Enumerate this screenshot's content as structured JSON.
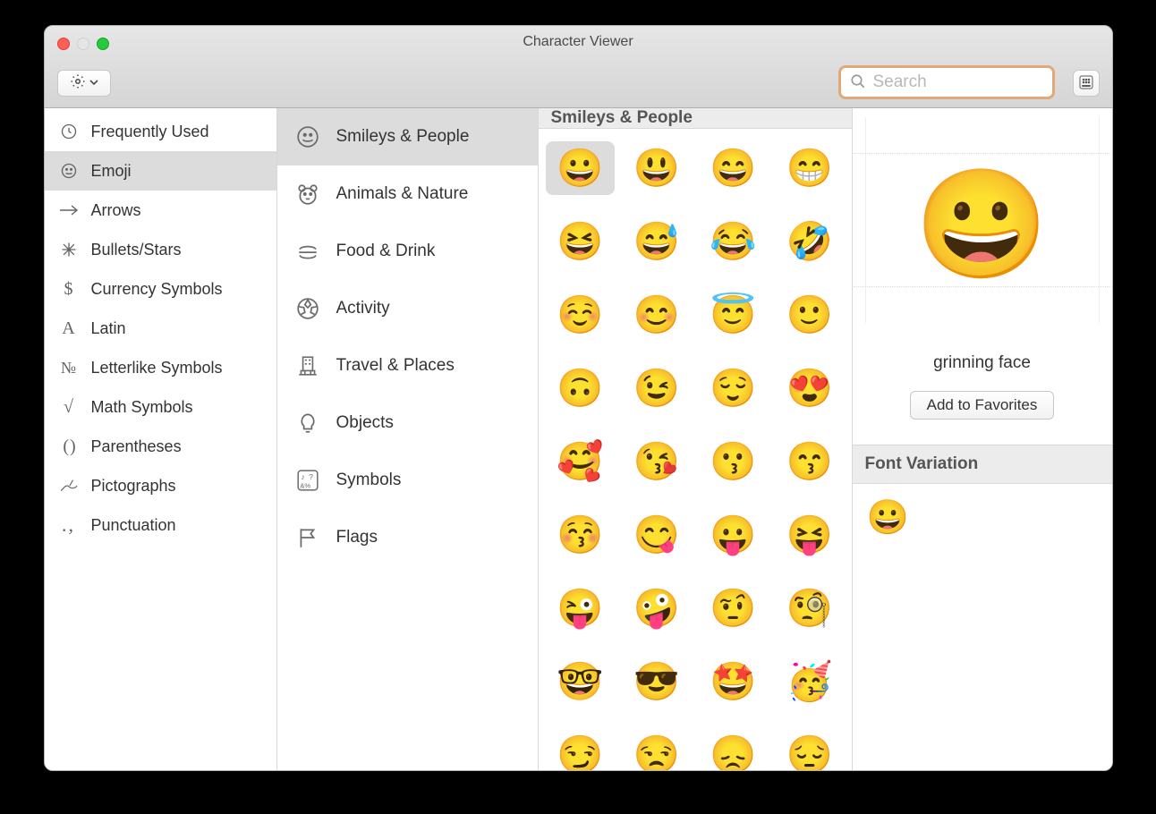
{
  "window": {
    "title": "Character Viewer"
  },
  "search": {
    "placeholder": "Search"
  },
  "sidebar": {
    "items": [
      {
        "label": "Frequently Used",
        "icon": "clock",
        "selected": false
      },
      {
        "label": "Emoji",
        "icon": "smile",
        "selected": true
      },
      {
        "label": "Arrows",
        "icon": "arrow",
        "selected": false
      },
      {
        "label": "Bullets/Stars",
        "icon": "star",
        "selected": false
      },
      {
        "label": "Currency Symbols",
        "icon": "dollar",
        "selected": false
      },
      {
        "label": "Latin",
        "icon": "A",
        "selected": false
      },
      {
        "label": "Letterlike Symbols",
        "icon": "No",
        "selected": false
      },
      {
        "label": "Math Symbols",
        "icon": "root",
        "selected": false
      },
      {
        "label": "Parentheses",
        "icon": "paren",
        "selected": false
      },
      {
        "label": "Pictographs",
        "icon": "hand",
        "selected": false
      },
      {
        "label": "Punctuation",
        "icon": "comma",
        "selected": false
      }
    ]
  },
  "categories": {
    "items": [
      {
        "label": "Smileys & People",
        "icon": "smile",
        "selected": true
      },
      {
        "label": "Animals & Nature",
        "icon": "bear",
        "selected": false
      },
      {
        "label": "Food & Drink",
        "icon": "burger",
        "selected": false
      },
      {
        "label": "Activity",
        "icon": "soccer",
        "selected": false
      },
      {
        "label": "Travel & Places",
        "icon": "building",
        "selected": false
      },
      {
        "label": "Objects",
        "icon": "bulb",
        "selected": false
      },
      {
        "label": "Symbols",
        "icon": "symbols",
        "selected": false
      },
      {
        "label": "Flags",
        "icon": "flag",
        "selected": false
      }
    ]
  },
  "grid": {
    "header": "Smileys & People",
    "emoji": [
      "😀",
      "😃",
      "😄",
      "😁",
      "😆",
      "😅",
      "😂",
      "🤣",
      "☺️",
      "😊",
      "😇",
      "🙂",
      "🙃",
      "😉",
      "😌",
      "😍",
      "🥰",
      "😘",
      "😗",
      "😙",
      "😚",
      "😋",
      "😛",
      "😝",
      "😜",
      "🤪",
      "🤨",
      "🧐",
      "🤓",
      "😎",
      "🤩",
      "🥳",
      "😏",
      "😒",
      "😞",
      "😔"
    ],
    "selected_index": 0
  },
  "detail": {
    "preview": "😀",
    "name": "grinning face",
    "favorites_button": "Add to Favorites",
    "font_variation_header": "Font Variation",
    "font_variation_sample": "😀"
  }
}
